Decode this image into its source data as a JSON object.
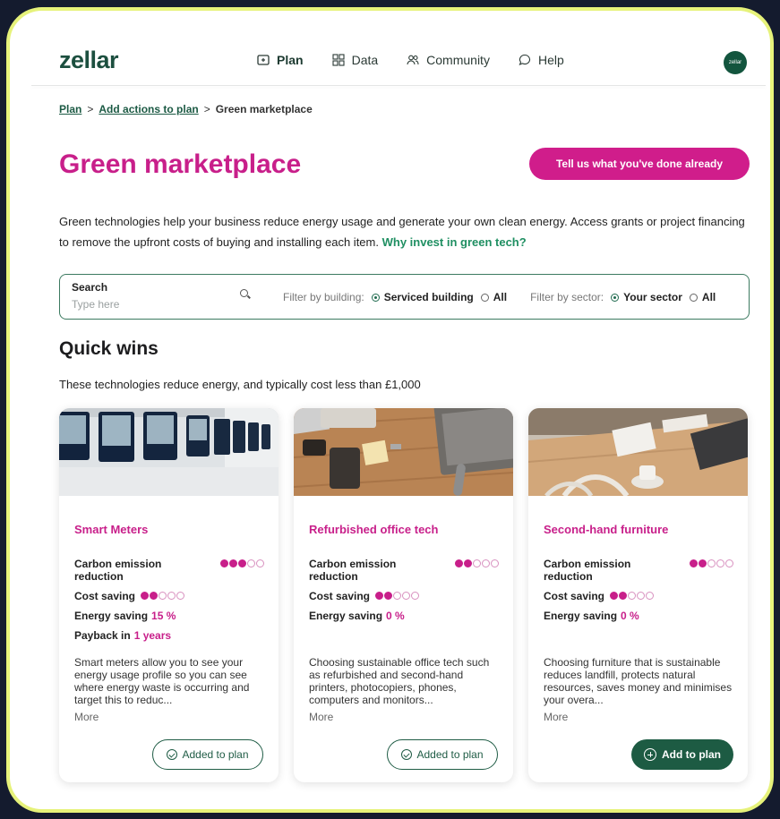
{
  "app": {
    "logo": "zellar",
    "avatar_text": "zellar"
  },
  "nav": {
    "items": [
      {
        "label": "Plan",
        "icon": "plan-icon",
        "active": true
      },
      {
        "label": "Data",
        "icon": "grid-icon",
        "active": false
      },
      {
        "label": "Community",
        "icon": "people-icon",
        "active": false
      },
      {
        "label": "Help",
        "icon": "chat-icon",
        "active": false
      }
    ]
  },
  "breadcrumb": {
    "first": "Plan",
    "second": "Add actions to plan",
    "current": "Green marketplace",
    "separator": ">"
  },
  "page": {
    "title": "Green marketplace",
    "cta": "Tell us what you've done already",
    "intro": "Green technologies help your business reduce energy usage and generate your own clean energy. Access grants or project financing to remove the upfront costs of buying and installing each item.",
    "intro_link": "Why invest in green tech?"
  },
  "filter": {
    "search_label": "Search",
    "search_placeholder": "Type here",
    "building_label": "Filter by building:",
    "building_selected": "Serviced building",
    "building_other": "All",
    "sector_label": "Filter by sector:",
    "sector_selected": "Your sector",
    "sector_other": "All"
  },
  "section": {
    "title": "Quick wins",
    "subtitle": "These technologies reduce energy, and typically cost less than £1,000"
  },
  "cards": [
    {
      "title": "Smart Meters",
      "carbon_label": "Carbon emission reduction",
      "carbon_level": 3,
      "cost_label": "Cost saving",
      "cost_level": 2,
      "energy_label": "Energy saving",
      "energy_value": "15 %",
      "payback_label": "Payback in",
      "payback_value": "1 years",
      "description": "Smart meters allow you to see your energy usage profile so you can see where energy waste is occurring and target this to reduc...",
      "more": "More",
      "button": "Added to plan",
      "added": true
    },
    {
      "title": "Refurbished office tech",
      "carbon_label": "Carbon emission reduction",
      "carbon_level": 2,
      "cost_label": "Cost saving",
      "cost_level": 2,
      "energy_label": "Energy saving",
      "energy_value": "0 %",
      "description": "Choosing sustainable office tech such as refurbished and second-hand printers, photocopiers, phones, computers and monitors...",
      "more": "More",
      "button": "Added to plan",
      "added": true
    },
    {
      "title": "Second-hand furniture",
      "carbon_label": "Carbon emission reduction",
      "carbon_level": 2,
      "cost_label": "Cost saving",
      "cost_level": 2,
      "energy_label": "Energy saving",
      "energy_value": "0 %",
      "description": "Choosing furniture that is sustainable reduces landfill, protects natural resources, saves money and minimises your overa...",
      "more": "More",
      "button": "Add to plan",
      "added": false
    }
  ],
  "colors": {
    "brand_green": "#1d5b43",
    "accent_pink": "#c81f8a",
    "frame": "#e6f27a",
    "background": "#141b2e"
  }
}
